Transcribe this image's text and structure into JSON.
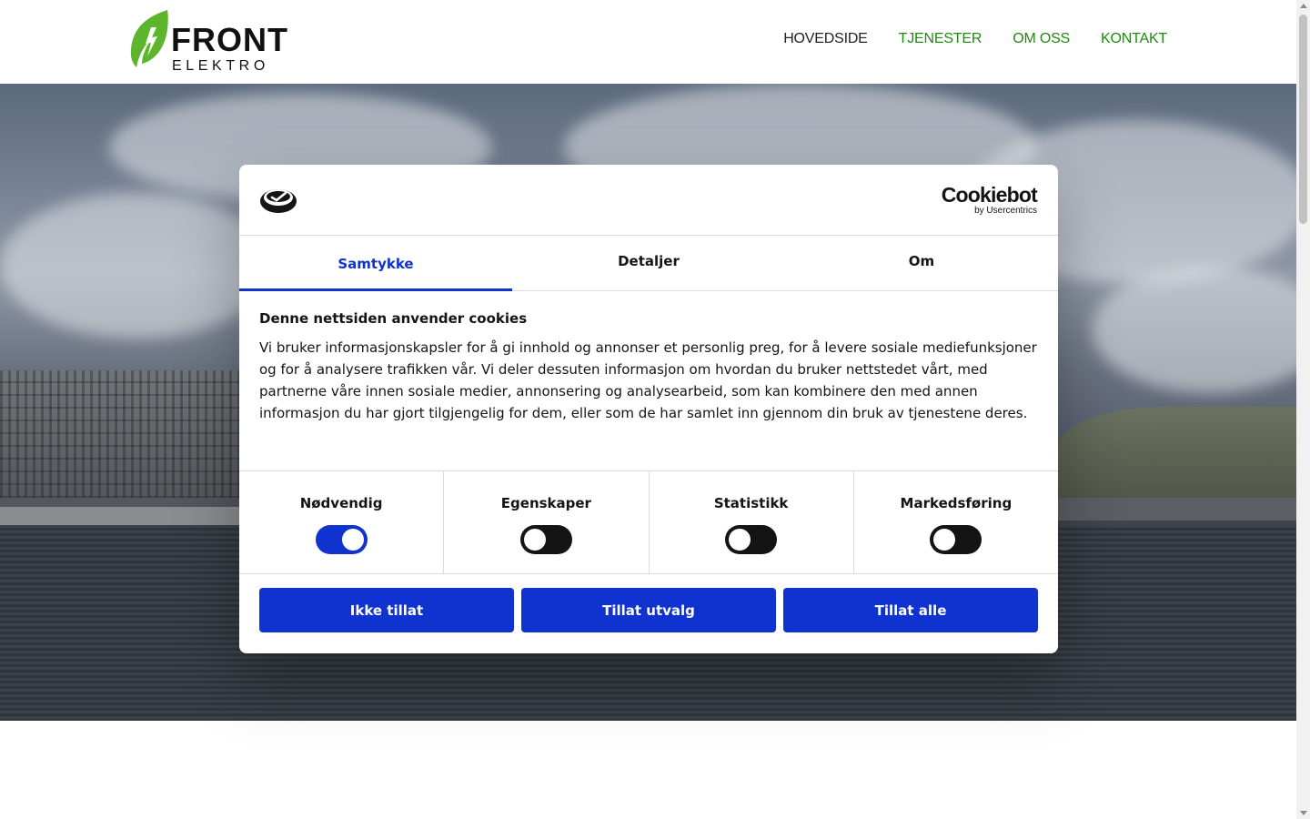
{
  "logo": {
    "line1": "FRONT",
    "line2": "ELEKTRO",
    "leaf_color": "#5db52b"
  },
  "nav": {
    "items": [
      {
        "label": "HOVEDSIDE",
        "active": true
      },
      {
        "label": "TJENESTER",
        "active": false
      },
      {
        "label": "OM OSS",
        "active": false
      },
      {
        "label": "KONTAKT",
        "active": false
      }
    ],
    "accent_color": "#1f8a0f"
  },
  "cookie_dialog": {
    "brand_main": "Cookiebot",
    "brand_sub": "by Usercentrics",
    "tabs": [
      {
        "label": "Samtykke",
        "active": true
      },
      {
        "label": "Detaljer",
        "active": false
      },
      {
        "label": "Om",
        "active": false
      }
    ],
    "title": "Denne nettsiden anvender cookies",
    "body": "Vi bruker informasjonskapsler for å gi innhold og annonser et personlig preg, for å levere sosiale mediefunksjoner og for å analysere trafikken vår. Vi deler dessuten informasjon om hvordan du bruker nettstedet vårt, med partnerne våre innen sosiale medier, annonsering og analysearbeid, som kan kombinere den med annen informasjon du har gjort tilgjengelig for dem, eller som de har samlet inn gjennom din bruk av tjenestene deres.",
    "toggles": [
      {
        "label": "Nødvendig",
        "on": true
      },
      {
        "label": "Egenskaper",
        "on": false
      },
      {
        "label": "Statistikk",
        "on": false
      },
      {
        "label": "Markedsføring",
        "on": false
      }
    ],
    "buttons": {
      "deny": "Ikke tillat",
      "selection": "Tillat utvalg",
      "all": "Tillat alle"
    },
    "accent_color": "#1032cf"
  }
}
